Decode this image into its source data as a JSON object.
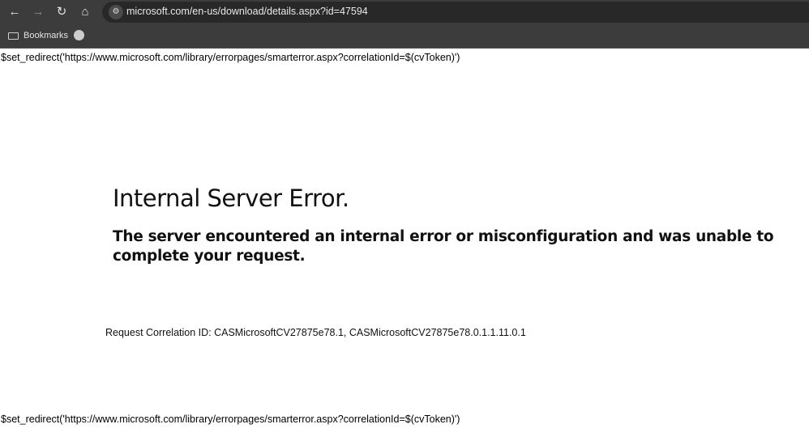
{
  "browser": {
    "url": "microsoft.com/en-us/download/details.aspx?id=47594",
    "bookmarks_label": "Bookmarks"
  },
  "page": {
    "redirect_top": "$set_redirect('https://www.microsoft.com/library/errorpages/smarterror.aspx?correlationId=$(cvToken)')",
    "title": "Internal Server Error.",
    "message": "The server encountered an internal error or misconfiguration and was unable to complete your request.",
    "correlation": "Request Correlation ID: CASMicrosoftCV27875e78.1, CASMicrosoftCV27875e78.0.1.1.11.0.1",
    "redirect_bottom": "$set_redirect('https://www.microsoft.com/library/errorpages/smarterror.aspx?correlationId=$(cvToken)')"
  }
}
